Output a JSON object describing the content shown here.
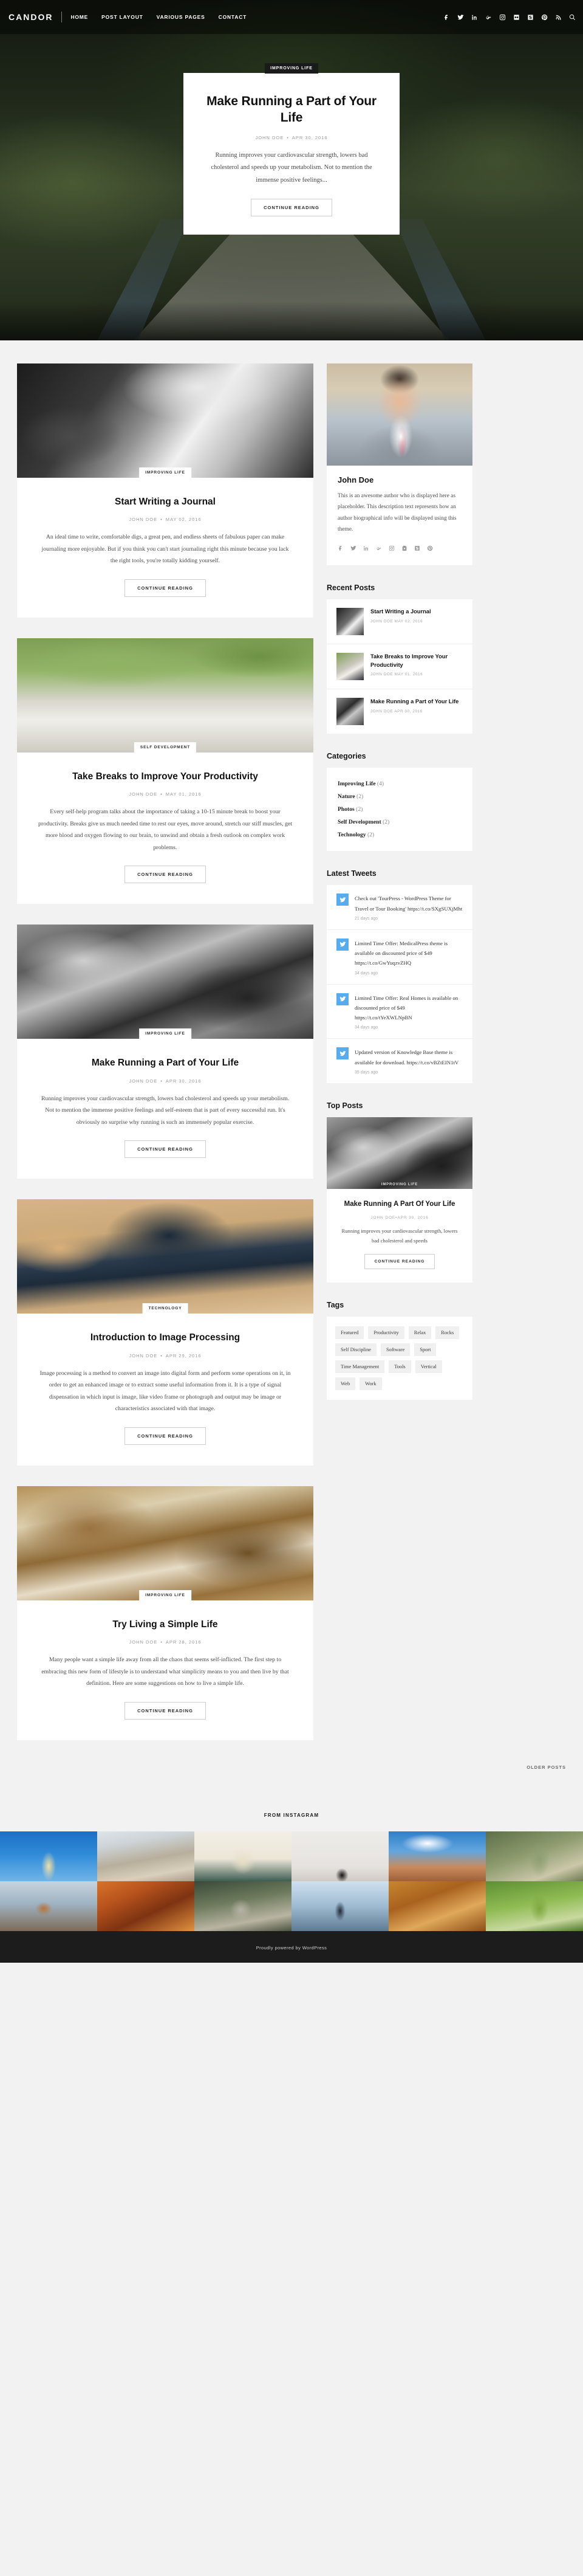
{
  "header": {
    "brand": "CANDOR",
    "nav": [
      {
        "label": "HOME"
      },
      {
        "label": "POST LAYOUT"
      },
      {
        "label": "VARIOUS PAGES"
      },
      {
        "label": "CONTACT"
      }
    ],
    "social_icons": [
      "facebook-icon",
      "twitter-icon",
      "linkedin-icon",
      "google-plus-icon",
      "instagram-icon",
      "flickr-icon",
      "skype-icon",
      "pinterest-icon",
      "rss-icon",
      "search-icon"
    ]
  },
  "hero": {
    "category": "IMPROVING LIFE",
    "title": "Make Running a Part of Your Life",
    "author": "JOHN DOE",
    "date": "APR 30, 2016",
    "excerpt": "Running improves your cardiovascular strength, lowers bad cholesterol and speeds up your metabolism. Not to mention the immense positive feelings...",
    "cta": "CONTINUE READING"
  },
  "posts": [
    {
      "category": "IMPROVING LIFE",
      "title": "Start Writing a Journal",
      "author": "JOHN DOE",
      "date": "MAY 02, 2016",
      "excerpt": "An ideal time to write, comfortable digs, a great pen, and endless sheets of fabulous paper can make journaling more enjoyable. But if you think you can't start journaling right this minute because you lack the right tools, you're totally kidding yourself.",
      "cta": "CONTINUE READING",
      "image": "hand-writing-in-notebook",
      "image_class": "img-journal"
    },
    {
      "category": "SELF DEVELOPMENT",
      "title": "Take Breaks to Improve Your Productivity",
      "author": "JOHN DOE",
      "date": "MAY 01, 2016",
      "excerpt": "Every self-help program talks about the importance of taking a 10-15 minute break to boost your productivity. Breaks give us much needed time to rest our eyes, move around, stretch our stiff muscles, get more blood and oxygen flowing to our brain, to unwind and obtain a fresh outlook on complex work problems.",
      "cta": "CONTINUE READING",
      "image": "person-walking-on-path",
      "image_class": "img-walk"
    },
    {
      "category": "IMPROVING LIFE",
      "title": "Make Running a Part of Your Life",
      "author": "JOHN DOE",
      "date": "APR 30, 2016",
      "excerpt": "Running improves your cardiovascular strength, lowers bad cholesterol and speeds up your metabolism. Not to mention the immense positive feelings and self-esteem that is part of every successful run. It's obviously no surprise why running is such an immensely popular exercise.",
      "cta": "CONTINUE READING",
      "image": "runners-at-starting-line",
      "image_class": "img-running"
    },
    {
      "category": "TECHNOLOGY",
      "title": "Introduction to Image Processing",
      "author": "JOHN DOE",
      "date": "APR 29, 2016",
      "excerpt": "Image processing is a method to convert an image into digital form and perform some operations on it, in order to get an enhanced image or to extract some useful information from it. It is a type of signal dispensation in which input is image, like video frame or photograph and output may be image or characteristics associated with that image.",
      "cta": "CONTINUE READING",
      "image": "laptop-on-desk",
      "image_class": "img-desk"
    },
    {
      "category": "IMPROVING LIFE",
      "title": "Try Living a Simple Life",
      "author": "JOHN DOE",
      "date": "APR 28, 2016",
      "excerpt": "Many people want a simple life away from all the chaos that seems self-inflicted. The first step to embracing this new form of lifestyle is to understand what simplicity means to you and then live by that definition. Here are some suggestions on how to live a simple life.",
      "cta": "CONTINUE READING",
      "image": "porch-swing",
      "image_class": "img-porch"
    }
  ],
  "pagination": {
    "older_label": "OLDER POSTS"
  },
  "sidebar": {
    "author": {
      "photo": "man-in-suit-portrait",
      "name": "John Doe",
      "bio": "This is an awesome author who is displayed here as placeholder. This description text represents how an author biographical info will be displayed using this theme.",
      "social_icons": [
        "facebook-icon",
        "twitter-icon",
        "linkedin-icon",
        "google-plus-icon",
        "instagram-icon",
        "youtube-icon",
        "skype-icon",
        "pinterest-icon"
      ]
    },
    "recent_posts": {
      "title": "Recent Posts",
      "items": [
        {
          "title": "Start Writing a Journal",
          "meta": "JOHN DOE MAY 02, 2016",
          "thumb_class": "rp-t1"
        },
        {
          "title": "Take Breaks to Improve Your Productivity",
          "meta": "JOHN DOE MAY 01, 2016",
          "thumb_class": "rp-t2"
        },
        {
          "title": "Make Running a Part of Your Life",
          "meta": "JOHN DOE APR 30, 2016",
          "thumb_class": "rp-t3"
        }
      ]
    },
    "categories": {
      "title": "Categories",
      "items": [
        {
          "label": "Improving Life",
          "count": "(4)"
        },
        {
          "label": "Nature",
          "count": "(2)"
        },
        {
          "label": "Photos",
          "count": "(2)"
        },
        {
          "label": "Self Development",
          "count": "(2)"
        },
        {
          "label": "Technology",
          "count": "(2)"
        }
      ]
    },
    "tweets": {
      "title": "Latest Tweets",
      "items": [
        {
          "text": "Check out 'TourPress - WordPress Theme for Travel or Tour Booking' https://t.co/SXgSUXjMht",
          "time": "21 days ago"
        },
        {
          "text": "Limited Time Offer: MedicalPress theme is available on discounted price of $49 https://t.co/GwYuqzvZHQ",
          "time": "34 days ago"
        },
        {
          "text": "Limited Time Offer: Real Homes is available on discounted price of $49 https://t.co/tYeXWLNpBN",
          "time": "34 days ago"
        },
        {
          "text": "Updated version of Knowledge Base theme is available for download. https://t.co/vBZtEIN1tV",
          "time": "35 days ago"
        }
      ]
    },
    "top_posts": {
      "title": "Top Posts",
      "item": {
        "category": "IMPROVING LIFE",
        "title": "Make Running A Part Of Your Life",
        "author": "JOHN DOE",
        "date": "APR 30, 2016",
        "excerpt": "Running improves your cardiovascular strength, lowers bad cholesterol and speeds",
        "cta": "CONTINUE READING"
      }
    },
    "tags": {
      "title": "Tags",
      "items": [
        "Featured",
        "Productivity",
        "Relax",
        "Rocks",
        "Self Discipline",
        "Software",
        "Sport",
        "Time Management",
        "Tools",
        "Vertical",
        "Web",
        "Work"
      ]
    }
  },
  "instagram": {
    "heading": "FROM INSTAGRAM",
    "tiles": [
      {
        "alt": "lighthouse-at-night",
        "cls": "ig1"
      },
      {
        "alt": "sand-dunes",
        "cls": "ig2"
      },
      {
        "alt": "woven-basket",
        "cls": "ig3"
      },
      {
        "alt": "minimal-dome",
        "cls": "ig4"
      },
      {
        "alt": "hoodoo-rock-formation",
        "cls": "ig5"
      },
      {
        "alt": "bamboo-forest",
        "cls": "ig6"
      },
      {
        "alt": "wooden-pier",
        "cls": "ig7"
      },
      {
        "alt": "autumn-canyon",
        "cls": "ig8"
      },
      {
        "alt": "mossy-rock",
        "cls": "ig9"
      },
      {
        "alt": "person-on-dock",
        "cls": "ig10"
      },
      {
        "alt": "red-bench-in-autumn",
        "cls": "ig11"
      },
      {
        "alt": "cactus-garden",
        "cls": "ig12"
      }
    ]
  },
  "footer": {
    "text": "Proudly powered by WordPress"
  },
  "theme": {
    "accent": "#55acee",
    "dark": "#1c1c1c",
    "page_bg": "#f2f2f2",
    "card_bg": "#ffffff",
    "muted_text": "#a9a9a9"
  }
}
